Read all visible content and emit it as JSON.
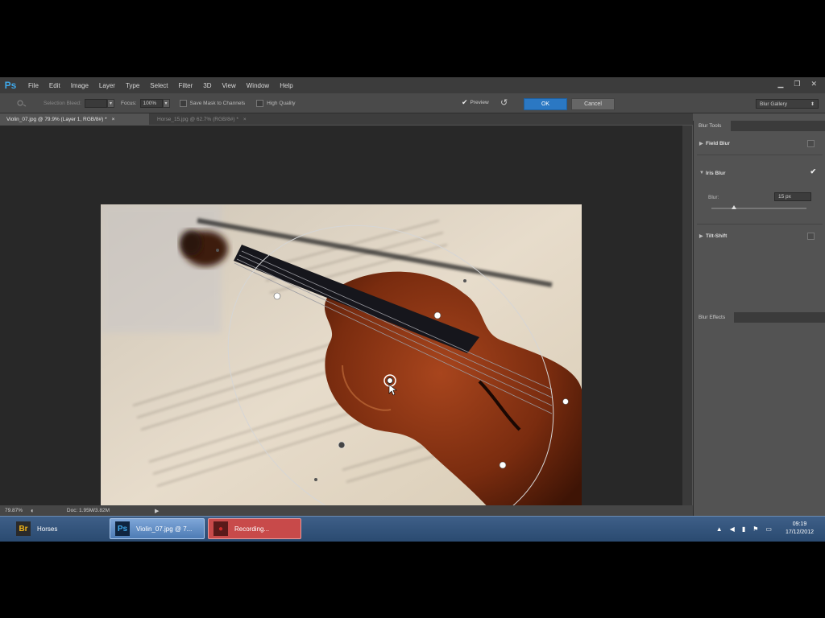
{
  "app": {
    "logo": "Ps"
  },
  "menu": [
    "File",
    "Edit",
    "Image",
    "Layer",
    "Type",
    "Select",
    "Filter",
    "3D",
    "View",
    "Window",
    "Help"
  ],
  "window_controls": {
    "minimize": "▁",
    "restore": "❐",
    "close": "✕"
  },
  "options": {
    "selection_bleed_label": "Selection Bleed:",
    "focus_label": "Focus:",
    "focus_value": "100%",
    "save_mask_label": "Save Mask to Channels",
    "high_quality_label": "High Quality",
    "preview_label": "Preview",
    "preview_checked": true,
    "ok_label": "OK",
    "cancel_label": "Cancel",
    "gallery_select": "Blur Gallery"
  },
  "tabs": {
    "active": "Violin_07.jpg @ 79.9% (Layer 1, RGB/8#) *",
    "inactive": "Horse_15.jpg @ 62.7% (RGB/8#) *"
  },
  "panel": {
    "blur_tools_title": "Blur Tools",
    "field_blur_label": "Field Blur",
    "iris_blur_label": "Iris Blur",
    "blur_label": "Blur:",
    "blur_value": "15 px",
    "blur_slider_fraction": 0.24,
    "tilt_shift_label": "Tilt-Shift",
    "blur_effects_title": "Blur Effects"
  },
  "status": {
    "zoom": "79.87%",
    "doc": "Doc: 1.95M/3.82M"
  },
  "taskbar": {
    "items": [
      {
        "icon": "Br",
        "label": "Horses",
        "icon_color": "#f0b419",
        "icon_bg": "#2a2a2a"
      },
      {
        "icon": "Ps",
        "label": "Violin_07.jpg @ 7...",
        "icon_color": "#3fa7e8",
        "icon_bg": "#0f2540"
      },
      {
        "icon": "●",
        "label": "Recording...",
        "icon_color": "#cc2a2a",
        "icon_bg": "#5a1a1a"
      }
    ],
    "clock_time": "09:19",
    "clock_date": "17/12/2012"
  },
  "colors": {
    "accent": "#2b78c3",
    "recording": "#c84a4a"
  }
}
